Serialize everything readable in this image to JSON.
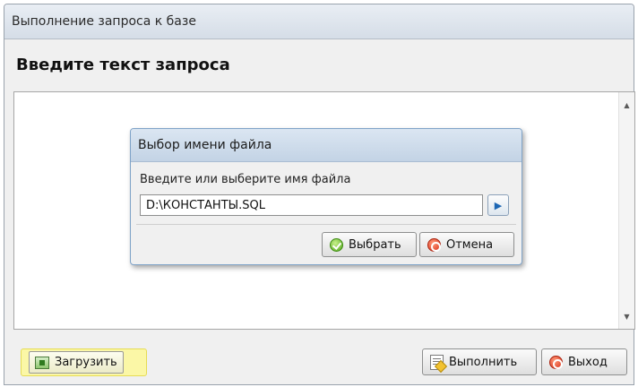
{
  "window": {
    "title": "Выполнение запроса к базе"
  },
  "main": {
    "heading": "Введите текст запроса"
  },
  "dialog": {
    "title": "Выбор имени файла",
    "prompt": "Введите или выберите имя файла",
    "file_name": "D:\\КОНСТАНТЫ.SQL",
    "select_label": "Выбрать",
    "cancel_label": "Отмена"
  },
  "footer": {
    "load_label": "Загрузить",
    "execute_label": "Выполнить",
    "exit_label": "Выход"
  },
  "colors": {
    "highlight": "#fbf7a6",
    "accent": "#1d66b4"
  }
}
